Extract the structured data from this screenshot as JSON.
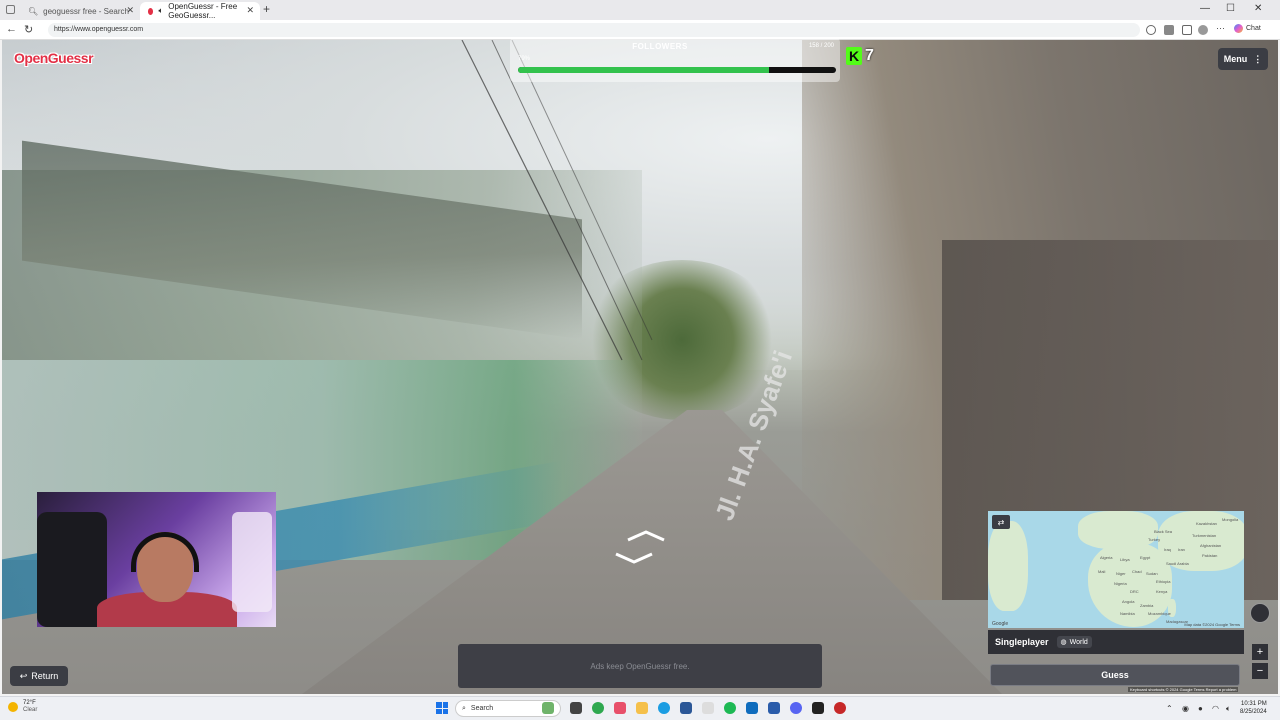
{
  "browser": {
    "tabs": [
      {
        "label": "geoguessr free - Search"
      },
      {
        "label": "OpenGuessr - Free GeoGuessr..."
      }
    ],
    "url": "https://www.openguessr.com",
    "chat_label": "Chat"
  },
  "game": {
    "logo_text": "OpenGuessr",
    "followers": {
      "title": "FOLLOWERS",
      "count": "158 / 200",
      "percent_label": "79%",
      "progress": 0.79
    },
    "kick": {
      "logo": "K",
      "count": "7"
    },
    "menu_label": "Menu",
    "street_label": "Jl. H.A. Syafe'i",
    "ad_text": "Ads keep OpenGuessr free.",
    "return_label": "Return",
    "mode_label": "Singleplayer",
    "map_label": "World",
    "guess_label": "Guess",
    "map_attribution": "Map data ©2024 Google",
    "map_terms": "Terms",
    "map_google": "Google",
    "map_footer": "Keyboard shortcuts   © 2024 Google   Terms   Report a problem",
    "map_places": [
      "Algeria",
      "Libya",
      "Egypt",
      "Mali",
      "Niger",
      "Chad",
      "Sudan",
      "Nigeria",
      "Ethiopia",
      "Kenya",
      "DRC",
      "Angola",
      "Zambia",
      "Namibia",
      "Mozambique",
      "Madagascar",
      "Turkey",
      "Iran",
      "Iraq",
      "Saudi Arabia",
      "Afghanistan",
      "Pakistan",
      "Kazakhstan",
      "Mongolia",
      "Black Sea",
      "Turkmenistan"
    ]
  },
  "taskbar": {
    "weather_temp": "72°F",
    "weather_cond": "Clear",
    "search_placeholder": "Search",
    "time": "10:31 PM",
    "date": "8/25/2024"
  },
  "colors": {
    "logo_red": "#e33046",
    "progress_green": "#33c24d",
    "kick_green": "#53fc18",
    "panel_dark": "#3b3d44"
  }
}
